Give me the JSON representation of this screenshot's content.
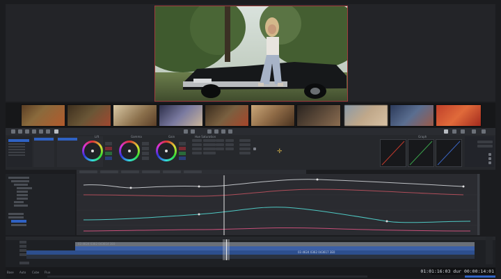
{
  "colors": {
    "accent": "#2f62c4",
    "selection": "#a23c3c",
    "curve_white": "#bfc2c6",
    "curve_red": "#b04e5a",
    "curve_cyan": "#4fc9c4",
    "curve_pink": "#c9507a",
    "playhead": "#e8e8e8",
    "timecode_bg": "#101113"
  },
  "viewer": {
    "scene": "Woman sitting on the hood of a black vintage convertible in a park"
  },
  "timecode": "01:01:16:03 dur 00:00:14:01",
  "clips": {
    "primary": "03 4624 0362 043614 3E0",
    "secondary": "03 4624 0362 043617 3E0"
  },
  "panel": {
    "lift": "Lift",
    "gamma": "Gamma",
    "gain": "Gain",
    "hue_saturation": "Hue Saturation",
    "graph": "Graph"
  },
  "sidebar": {
    "items": [
      "Colour",
      "Base",
      "Contrast",
      "Red",
      "Green",
      "Blue",
      "Matte",
      "Tint"
    ]
  },
  "status": {
    "items": [
      "Base",
      "Auto",
      "Cube",
      "Flux"
    ]
  }
}
